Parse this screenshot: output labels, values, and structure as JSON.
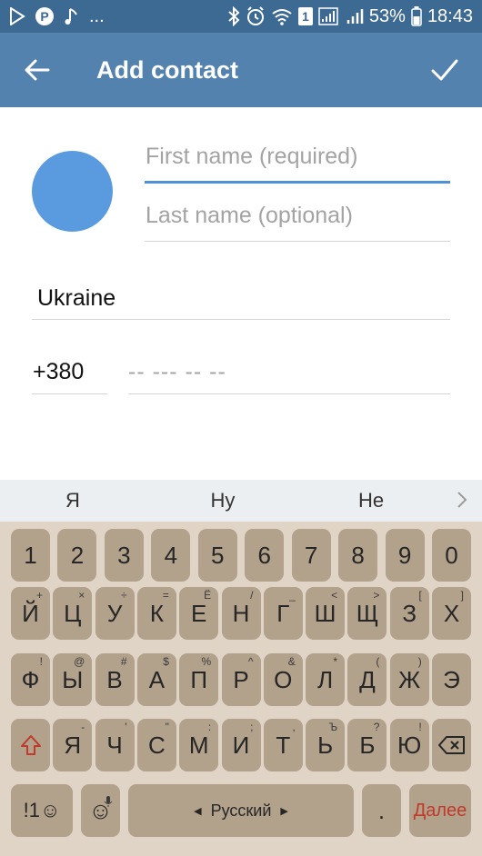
{
  "status_bar": {
    "left_icons": [
      "play-store-icon",
      "pinterest-icon",
      "music-note-icon"
    ],
    "more": "...",
    "battery": "53%",
    "time": "18:43",
    "sim_badge": "1"
  },
  "app_bar": {
    "title": "Add contact",
    "back_icon": "arrow-left-icon",
    "done_icon": "checkmark-icon"
  },
  "form": {
    "first_name_placeholder": "First name (required)",
    "last_name_placeholder": "Last name (optional)",
    "country": "Ukraine",
    "country_code": "+380",
    "phone_placeholder": "-- --- -- --",
    "avatar_color": "#5a9be0"
  },
  "suggestions": [
    "Я",
    "Ну",
    "Не"
  ],
  "keyboard": {
    "row1": [
      "1",
      "2",
      "3",
      "4",
      "5",
      "6",
      "7",
      "8",
      "9",
      "0"
    ],
    "row2": [
      {
        "k": "Й",
        "h": "+"
      },
      {
        "k": "Ц",
        "h": "×"
      },
      {
        "k": "У",
        "h": "÷"
      },
      {
        "k": "К",
        "h": "="
      },
      {
        "k": "Е",
        "h": "Ё"
      },
      {
        "k": "Н",
        "h": "/"
      },
      {
        "k": "Г",
        "h": "_"
      },
      {
        "k": "Ш",
        "h": "<"
      },
      {
        "k": "Щ",
        "h": ">"
      },
      {
        "k": "З",
        "h": "["
      },
      {
        "k": "Х",
        "h": "]"
      }
    ],
    "row3": [
      {
        "k": "Ф",
        "h": "!"
      },
      {
        "k": "Ы",
        "h": "@"
      },
      {
        "k": "В",
        "h": "#"
      },
      {
        "k": "А",
        "h": "$"
      },
      {
        "k": "П",
        "h": "%"
      },
      {
        "k": "Р",
        "h": "^"
      },
      {
        "k": "О",
        "h": "&"
      },
      {
        "k": "Л",
        "h": "*"
      },
      {
        "k": "Д",
        "h": "("
      },
      {
        "k": "Ж",
        "h": ")"
      },
      {
        "k": "Э",
        "h": ""
      }
    ],
    "row4": [
      {
        "k": "Я",
        "h": "-"
      },
      {
        "k": "Ч",
        "h": "'"
      },
      {
        "k": "С",
        "h": "\""
      },
      {
        "k": "М",
        "h": ":"
      },
      {
        "k": "И",
        "h": ";"
      },
      {
        "k": "Т",
        "h": ","
      },
      {
        "k": "Ь",
        "h": "Ъ"
      },
      {
        "k": "Б",
        "h": "?"
      },
      {
        "k": "Ю",
        "h": "!"
      }
    ],
    "symbols_label": "!1☺",
    "emoji_label": "☺",
    "space_label": "Русский",
    "period_label": ".",
    "enter_label": "Далее",
    "shift_color": "#c0392b"
  }
}
